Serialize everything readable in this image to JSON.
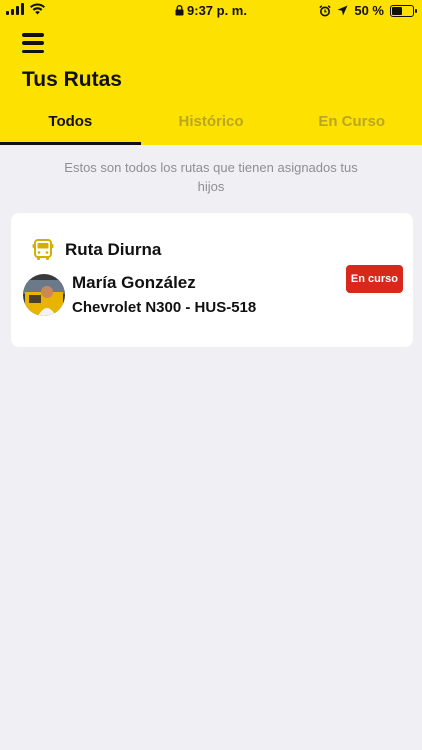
{
  "status_bar": {
    "time": "9:37 p. m.",
    "battery": "50 %",
    "battery_level": 0.5
  },
  "header": {
    "title": "Tus Rutas",
    "background": "#fde100"
  },
  "tabs": [
    {
      "label": "Todos",
      "active": true
    },
    {
      "label": "Histórico",
      "active": false
    },
    {
      "label": "En Curso",
      "active": false
    }
  ],
  "subtitle": "Estos son todos los rutas que tienen asignados tus hijos",
  "routes": [
    {
      "name": "Ruta Diurna",
      "icon": "bus-icon",
      "driver": "María González",
      "vehicle": "Chevrolet N300 - HUS-518",
      "status": "En curso",
      "status_color": "#d8281c"
    }
  ]
}
